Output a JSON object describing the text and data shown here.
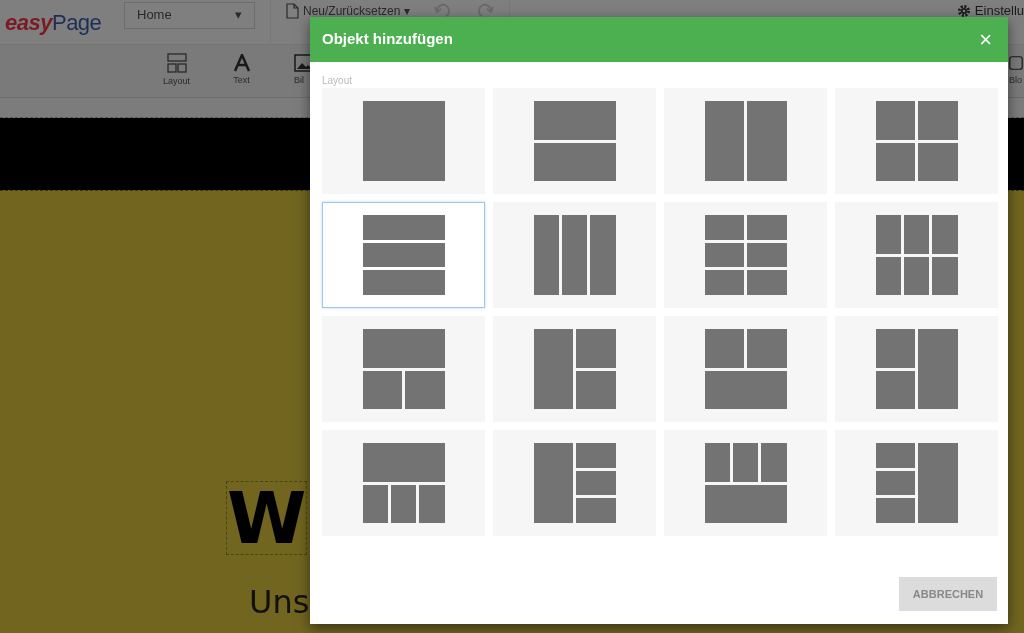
{
  "app": {
    "logo": {
      "first": "easy",
      "second": "Page"
    },
    "page_select": {
      "value": "Home",
      "caret": "▾"
    },
    "new_reset": {
      "label": "Neu/Zurücksetzen",
      "caret": "▾"
    },
    "undo": {
      "disabled": true
    },
    "redo": {
      "disabled": true
    },
    "settings": {
      "label": "Einstellu"
    }
  },
  "toolbar": [
    {
      "kind": "layout",
      "label": "Layout"
    },
    {
      "kind": "text",
      "label": "Text"
    },
    {
      "kind": "image",
      "label": "Bil"
    },
    {
      "kind": "blog",
      "label": "Blo"
    }
  ],
  "canvas": {
    "heading": "W",
    "subtitle": "Uns"
  },
  "dialog": {
    "title": "Objekt hinzufügen",
    "close": "×",
    "section": "Layout",
    "layouts": [
      {
        "kind": "single",
        "selected": false
      },
      {
        "kind": "two-rows",
        "selected": false
      },
      {
        "kind": "two-columns",
        "selected": false
      },
      {
        "kind": "grid-two",
        "selected": false
      },
      {
        "kind": "three-rows",
        "selected": true
      },
      {
        "kind": "three-columns",
        "selected": false
      },
      {
        "kind": "rows-two-columns",
        "selected": false
      },
      {
        "kind": "columns-three-two",
        "selected": false
      },
      {
        "kind": "top-wide-two-below",
        "selected": false
      },
      {
        "kind": "left-tall-two-right",
        "selected": false
      },
      {
        "kind": "two-top-wide-below",
        "selected": false
      },
      {
        "kind": "right-tall-two-left",
        "selected": false
      },
      {
        "kind": "top-wide-three-below",
        "selected": false
      },
      {
        "kind": "left-tall-three-right",
        "selected": false
      },
      {
        "kind": "three-top-wide-below",
        "selected": false
      },
      {
        "kind": "right-tall-three-left",
        "selected": false
      }
    ],
    "cancel": "ABBRECHEN"
  }
}
